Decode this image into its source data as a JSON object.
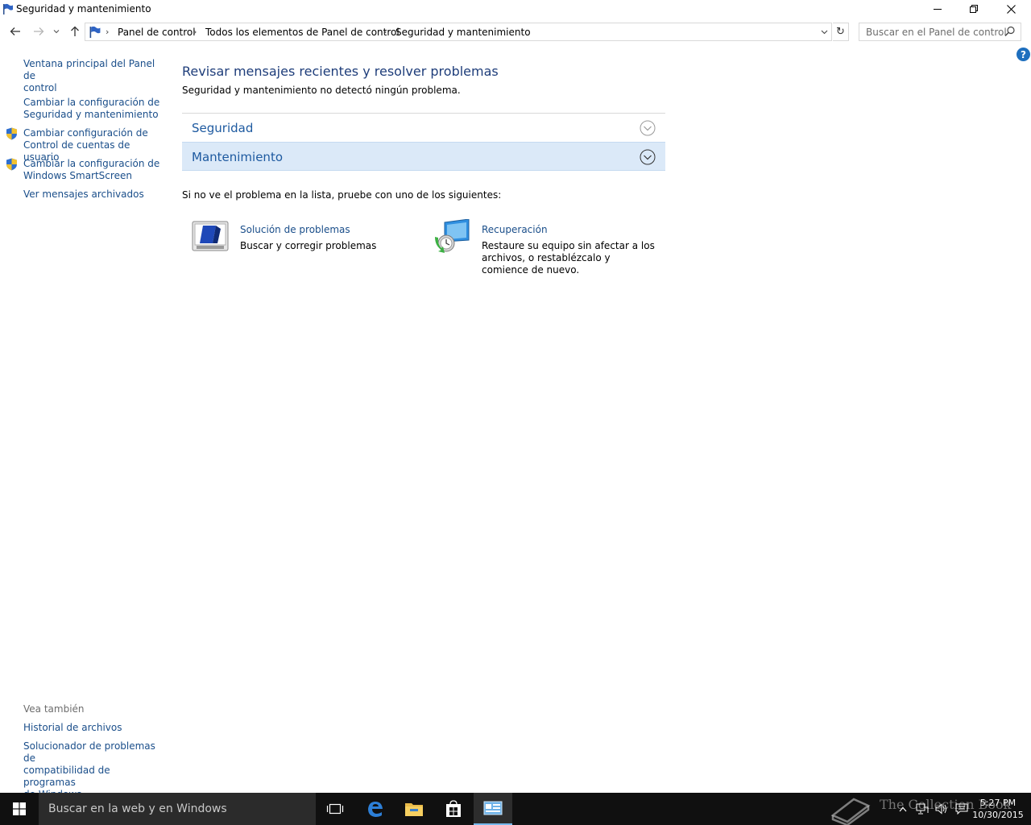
{
  "window": {
    "title": "Seguridad y mantenimiento",
    "controls": {
      "minimize": "minimize-icon",
      "maximize": "restore-icon",
      "close": "close-icon"
    }
  },
  "address": {
    "crumbs": [
      "Panel de control",
      "Todos los elementos de Panel de control",
      "Seguridad y mantenimiento"
    ],
    "search_placeholder": "Buscar en el Panel de control"
  },
  "sidebar": {
    "links": [
      {
        "label1": "Ventana principal del Panel de",
        "label2": "control",
        "shield": false
      },
      {
        "label1": "Cambiar la configuración de",
        "label2": "Seguridad y mantenimiento",
        "shield": false
      },
      {
        "label1": "Cambiar configuración de",
        "label2": "Control de cuentas de usuario",
        "shield": true
      },
      {
        "label1": "Cambiar la configuración de",
        "label2": "Windows SmartScreen",
        "shield": true
      },
      {
        "label1": "Ver mensajes archivados",
        "label2": "",
        "shield": false
      }
    ],
    "see_also_label": "Vea también",
    "see_also": [
      {
        "label1": "Historial de archivos"
      },
      {
        "label1": "Solucionador de problemas de",
        "label2": "compatibilidad de programas",
        "label3": "de Windows"
      }
    ]
  },
  "main": {
    "title": "Revisar mensajes recientes y resolver problemas",
    "status": "Seguridad y mantenimiento no detectó ningún problema.",
    "sections": [
      {
        "title": "Seguridad",
        "selected": false
      },
      {
        "title": "Mantenimiento",
        "selected": true
      }
    ],
    "hint": "Si no ve el problema en la lista, pruebe con uno de los siguientes:",
    "tasks": [
      {
        "title": "Solución de problemas",
        "desc1": "Buscar y corregir problemas",
        "desc2": "",
        "desc3": ""
      },
      {
        "title": "Recuperación",
        "desc1": "Restaure su equipo sin afectar a los",
        "desc2": "archivos, o restablézcalo y",
        "desc3": "comience de nuevo."
      }
    ]
  },
  "taskbar": {
    "search_placeholder": "Buscar en la web y en Windows",
    "clock_time": "5:27 PM",
    "clock_date": "10/30/2015",
    "watermark": "The Collection Book",
    "accent": "#76b9ed"
  },
  "colors": {
    "link": "#1a4e8a",
    "title": "#1e3d7a",
    "section_selected_bg": "#dbe9f8"
  }
}
